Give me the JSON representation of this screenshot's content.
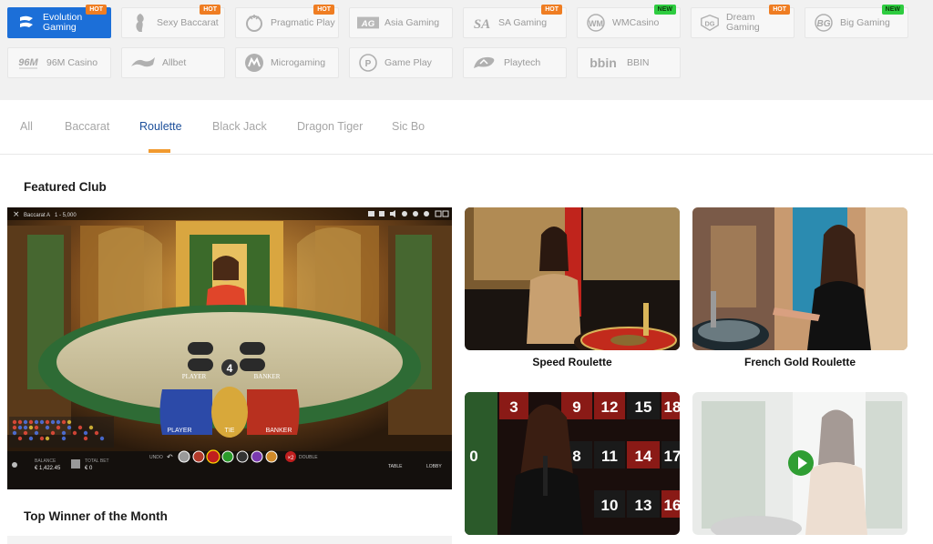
{
  "providers": [
    {
      "name": "Evolution Gaming",
      "logo": "EG",
      "badge": "HOT",
      "active": true
    },
    {
      "name": "Sexy Baccarat",
      "logo": "SB",
      "badge": "HOT"
    },
    {
      "name": "Pragmatic Play",
      "logo": "PP",
      "badge": "HOT"
    },
    {
      "name": "Asia Gaming",
      "logo": "AG",
      "badge": ""
    },
    {
      "name": "SA Gaming",
      "logo": "SA",
      "badge": "HOT"
    },
    {
      "name": "WMCasino",
      "logo": "WM",
      "badge": "NEW"
    },
    {
      "name": "Dream Gaming",
      "logo": "DG",
      "badge": "HOT"
    },
    {
      "name": "Big Gaming",
      "logo": "BG",
      "badge": "NEW"
    },
    {
      "name": "96M Casino",
      "logo": "96M",
      "badge": ""
    },
    {
      "name": "Allbet",
      "logo": "AB",
      "badge": ""
    },
    {
      "name": "Microgaming",
      "logo": "M",
      "badge": ""
    },
    {
      "name": "Game Play",
      "logo": "GP",
      "badge": ""
    },
    {
      "name": "Playtech",
      "logo": "PT",
      "badge": ""
    },
    {
      "name": "BBIN",
      "logo": "bbin",
      "badge": ""
    }
  ],
  "tabs": [
    "All",
    "Baccarat",
    "Roulette",
    "Black Jack",
    "Dragon Tiger",
    "Sic Bo"
  ],
  "active_tab": "Roulette",
  "featured_title": "Featured Club",
  "top_winner_title": "Top Winner of the Month",
  "video": {
    "table_label": "Baccarat A",
    "bet_limits": "1 - 5,000",
    "round_number": "4",
    "player_label": "PLAYER",
    "banker_label": "BANKER",
    "tie_label": "TIE",
    "balance_label": "BALANCE",
    "balance_value": "€ 1,422.45",
    "total_bet_label": "TOTAL BET",
    "total_bet_value": "€ 0",
    "undo_label": "UNDO",
    "double_label": "DOUBLE",
    "table_button": "TABLE",
    "lobby_button": "LOBBY"
  },
  "games": [
    {
      "title": "Speed Roulette"
    },
    {
      "title": "French Gold Roulette"
    },
    {
      "title": ""
    },
    {
      "title": ""
    }
  ],
  "colors": {
    "accent": "#f19a2f",
    "active_provider": "#1c6fd8",
    "active_tab_text": "#1c4f9a",
    "hot_badge": "#ef7d22",
    "new_badge": "#2ecc40"
  }
}
